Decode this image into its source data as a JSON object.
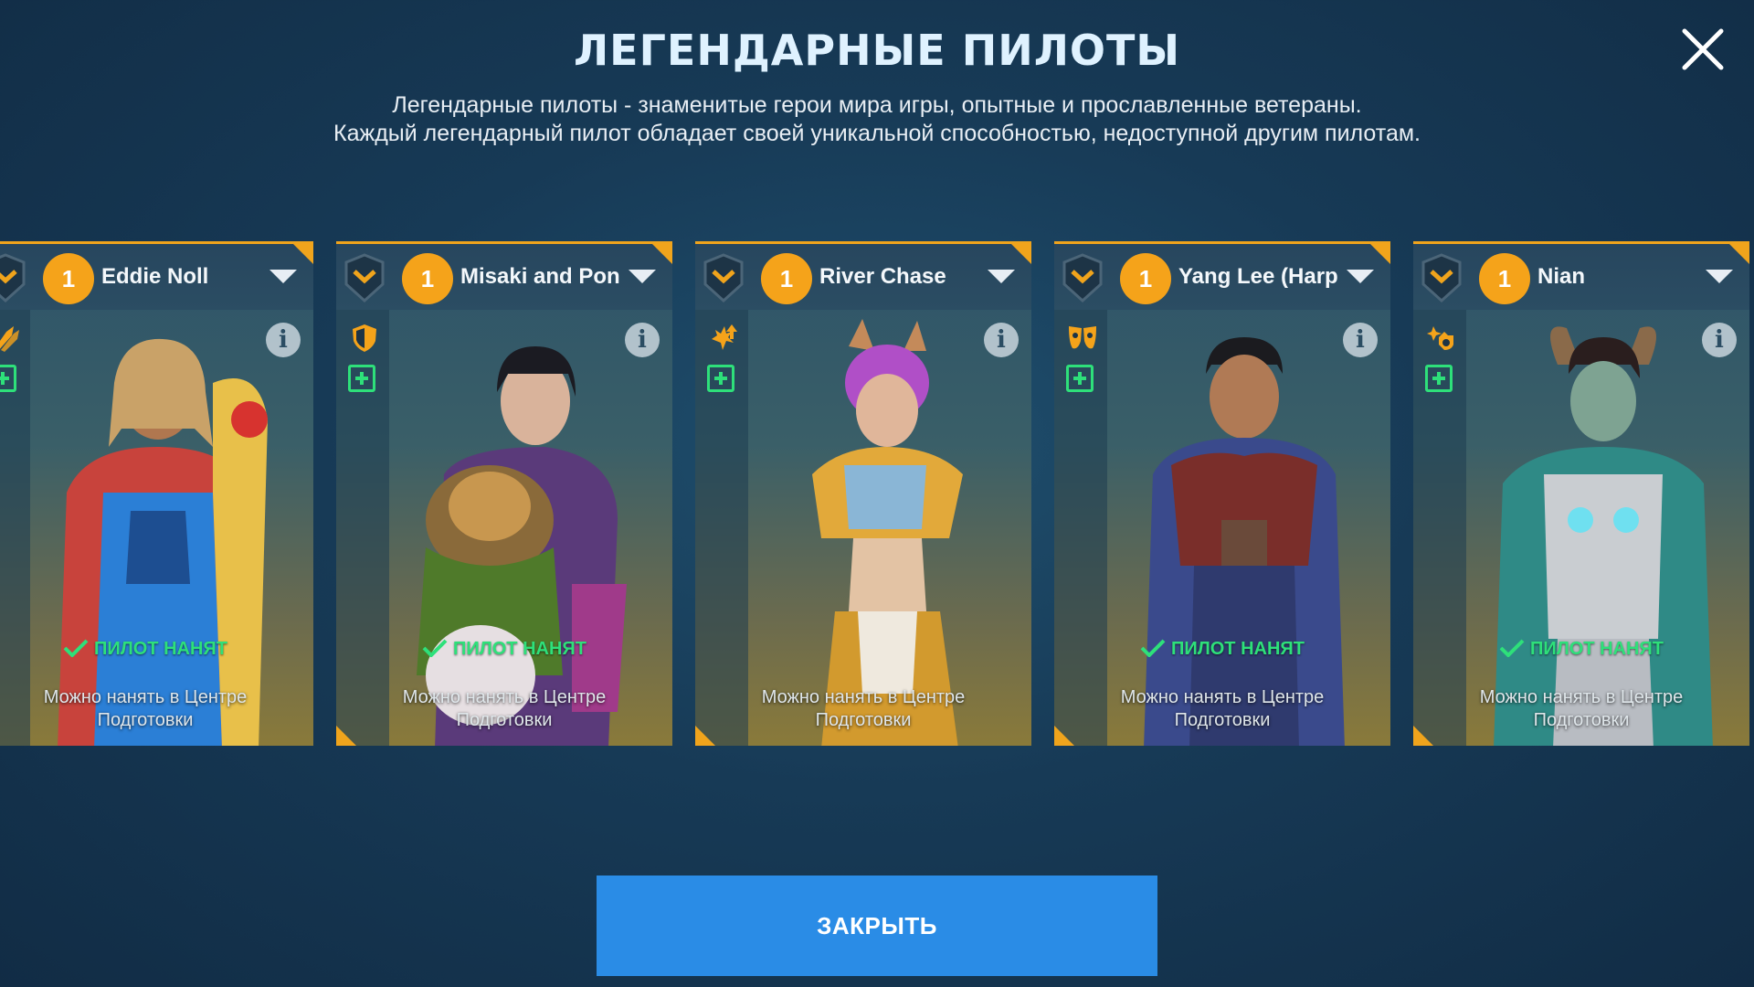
{
  "header": {
    "title": "ЛЕГЕНДАРНЫЕ ПИЛОТЫ",
    "subtitle_line1": "Легендарные пилоты - знаменитые герои мира игры, опытные и прославленные ветераны.",
    "subtitle_line2": "Каждый легендарный пилот обладает своей уникальной способностью, недоступной другим пилотам."
  },
  "close_icon": "close-x-icon",
  "cards": [
    {
      "level": "1",
      "name": "Eddie Noll",
      "skill_icon": "missile-icon",
      "hired": "ПИЛОТ НАНЯТ",
      "note": "Можно нанять в Центре Подготовки"
    },
    {
      "level": "1",
      "name": "Misaki and Pon",
      "skill_icon": "shield-icon",
      "hired": "ПИЛОТ НАНЯТ",
      "note": "Можно нанять в Центре Подготовки"
    },
    {
      "level": "1",
      "name": "River Chase",
      "skill_icon": "burst-arrow-icon",
      "hired": "",
      "note": "Можно нанять в Центре Подготовки"
    },
    {
      "level": "1",
      "name": "Yang Lee (Harp",
      "skill_icon": "mask-icon",
      "hired": "ПИЛОТ НАНЯТ",
      "note": "Можно нанять в Центре Подготовки"
    },
    {
      "level": "1",
      "name": "Nian",
      "skill_icon": "sparkle-hand-icon",
      "hired": "ПИЛОТ НАНЯТ",
      "note": "Можно нанять в Центре Подготовки"
    }
  ],
  "footer": {
    "close_label": "ЗАКРЫТЬ"
  },
  "colors": {
    "accent": "#f0a41c",
    "hired": "#2ee07a",
    "button": "#2a8ce6"
  }
}
